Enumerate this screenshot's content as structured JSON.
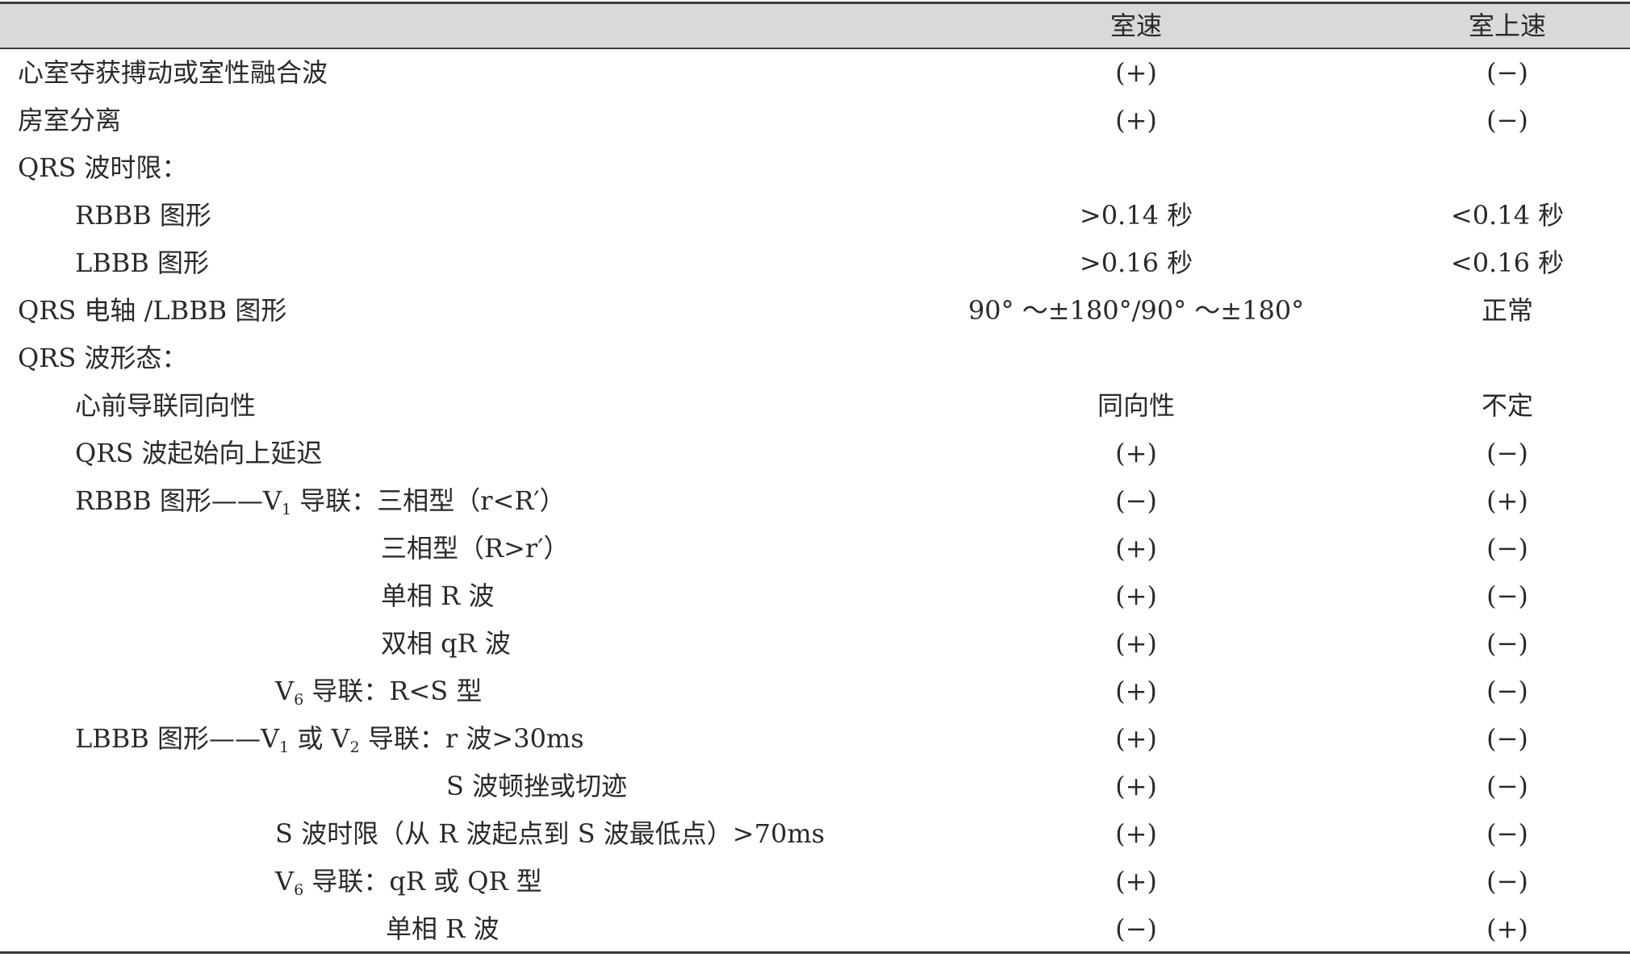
{
  "header": {
    "col1": "室速",
    "col2": "室上速"
  },
  "rows": [
    {
      "label": "心室夺获搏动或室性融合波",
      "vt": "(+)",
      "svt": "(−)"
    },
    {
      "label": "房室分离",
      "vt": "(+)",
      "svt": "(−)"
    },
    {
      "label": "QRS 波时限：",
      "vt": "",
      "svt": ""
    },
    {
      "label": "RBBB 图形",
      "vt": ">0.14 秒",
      "svt": "<0.14 秒"
    },
    {
      "label": "LBBB 图形",
      "vt": ">0.16 秒",
      "svt": "<0.16 秒"
    },
    {
      "label": "QRS 电轴 /LBBB 图形",
      "vt": "90° ～±180°/90° ～±180°",
      "svt": "正常"
    },
    {
      "label": "QRS 波形态：",
      "vt": "",
      "svt": ""
    },
    {
      "label": "心前导联同向性",
      "vt": "同向性",
      "svt": "不定"
    },
    {
      "label": "QRS 波起始向上延迟",
      "vt": "(+)",
      "svt": "(−)"
    },
    {
      "label_a": "RBBB 图形——V",
      "label_sub": "1",
      "label_b": " 导联：三相型（r<R′）",
      "vt": "(−)",
      "svt": "(+)"
    },
    {
      "label": "三相型（R>r′）",
      "vt": "(+)",
      "svt": "(−)"
    },
    {
      "label": "单相 R 波",
      "vt": "(+)",
      "svt": "(−)"
    },
    {
      "label": "双相 qR 波",
      "vt": "(+)",
      "svt": "(−)"
    },
    {
      "label_a": "V",
      "label_sub": "6",
      "label_b": " 导联：R<S 型",
      "vt": "(+)",
      "svt": "(−)"
    },
    {
      "label_a": "LBBB 图形——V",
      "label_sub": "1",
      "label_b": " 或 V",
      "label_sub2": "2",
      "label_c": " 导联：r 波>30ms",
      "vt": "(+)",
      "svt": "(−)"
    },
    {
      "label": "S 波顿挫或切迹",
      "vt": "(+)",
      "svt": "(−)"
    },
    {
      "label": "S 波时限（从 R 波起点到 S 波最低点）>70ms",
      "vt": "(+)",
      "svt": "(−)"
    },
    {
      "label_a": "V",
      "label_sub": "6",
      "label_b": " 导联：qR 或 QR 型",
      "vt": "(+)",
      "svt": "(−)"
    },
    {
      "label": "单相 R 波",
      "vt": "(−)",
      "svt": "(+)"
    }
  ]
}
